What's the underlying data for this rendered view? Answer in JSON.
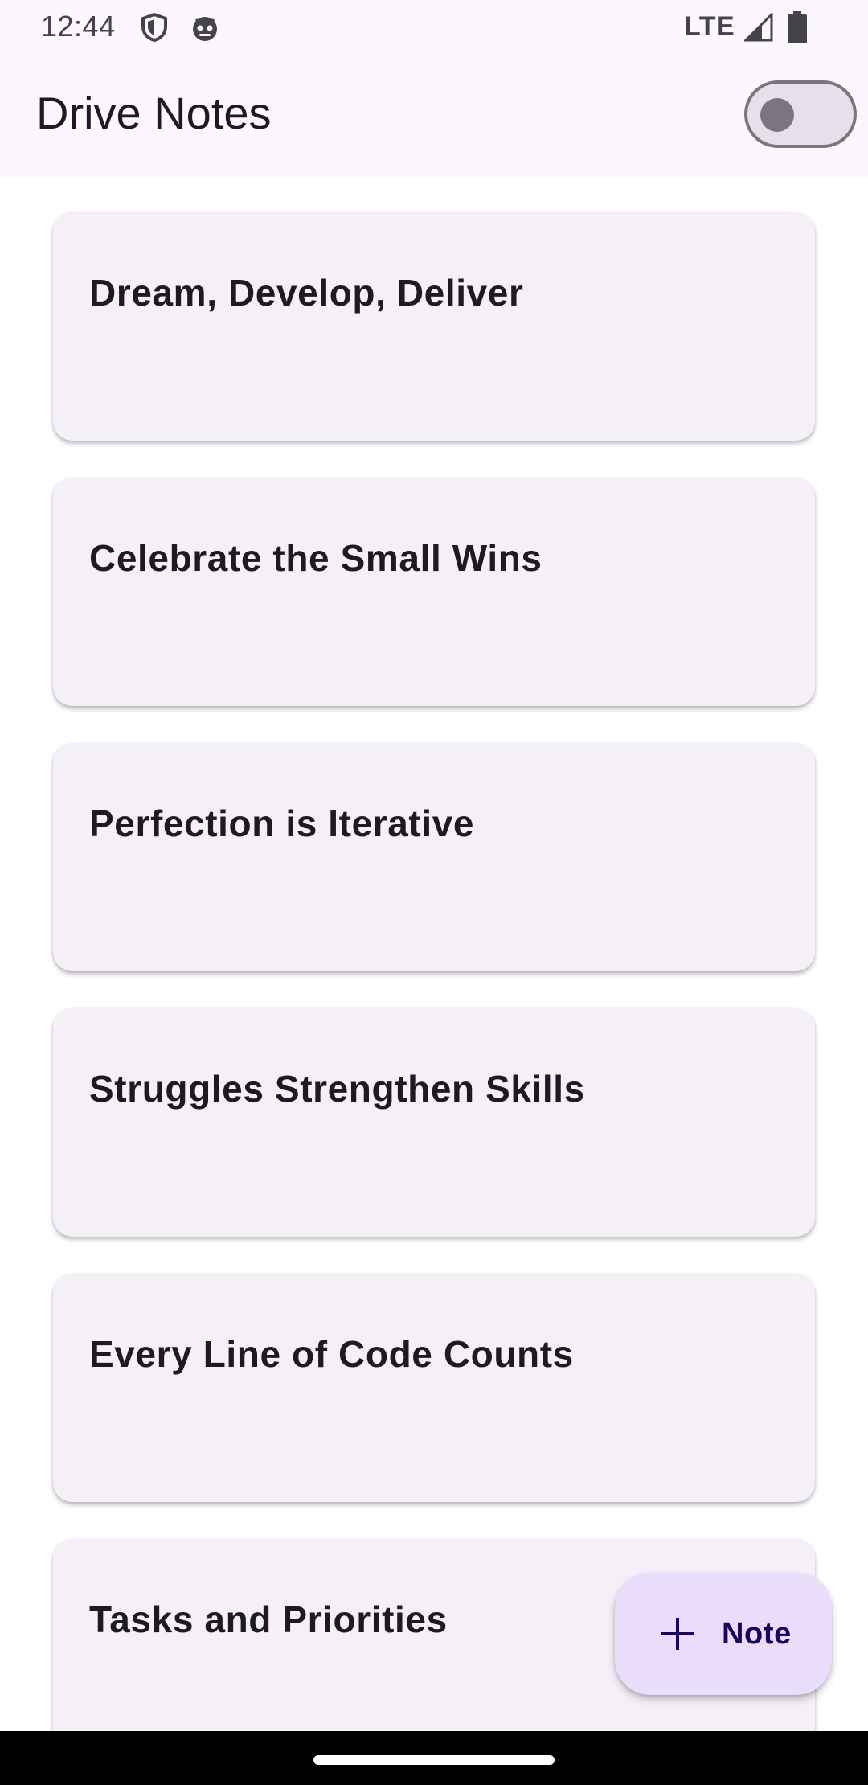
{
  "status_bar": {
    "time": "12:44",
    "network": "LTE",
    "icons": [
      "shield-icon",
      "robot-face-icon",
      "signal-icon",
      "battery-icon"
    ]
  },
  "app_bar": {
    "title": "Drive Notes",
    "toggle": {
      "state": "off"
    }
  },
  "notes": [
    {
      "title": "Dream, Develop, Deliver"
    },
    {
      "title": "Celebrate the Small Wins"
    },
    {
      "title": "Perfection is Iterative"
    },
    {
      "title": "Struggles Strengthen Skills"
    },
    {
      "title": "Every Line of Code Counts"
    },
    {
      "title": "Tasks and Priorities"
    }
  ],
  "fab": {
    "label": "Note",
    "icon": "plus-icon"
  },
  "colors": {
    "app_bar_bg": "#fcf7fd",
    "card_bg": "#f5f0f7",
    "fab_bg": "#e9ddfb",
    "text_primary": "#1d1b20"
  }
}
